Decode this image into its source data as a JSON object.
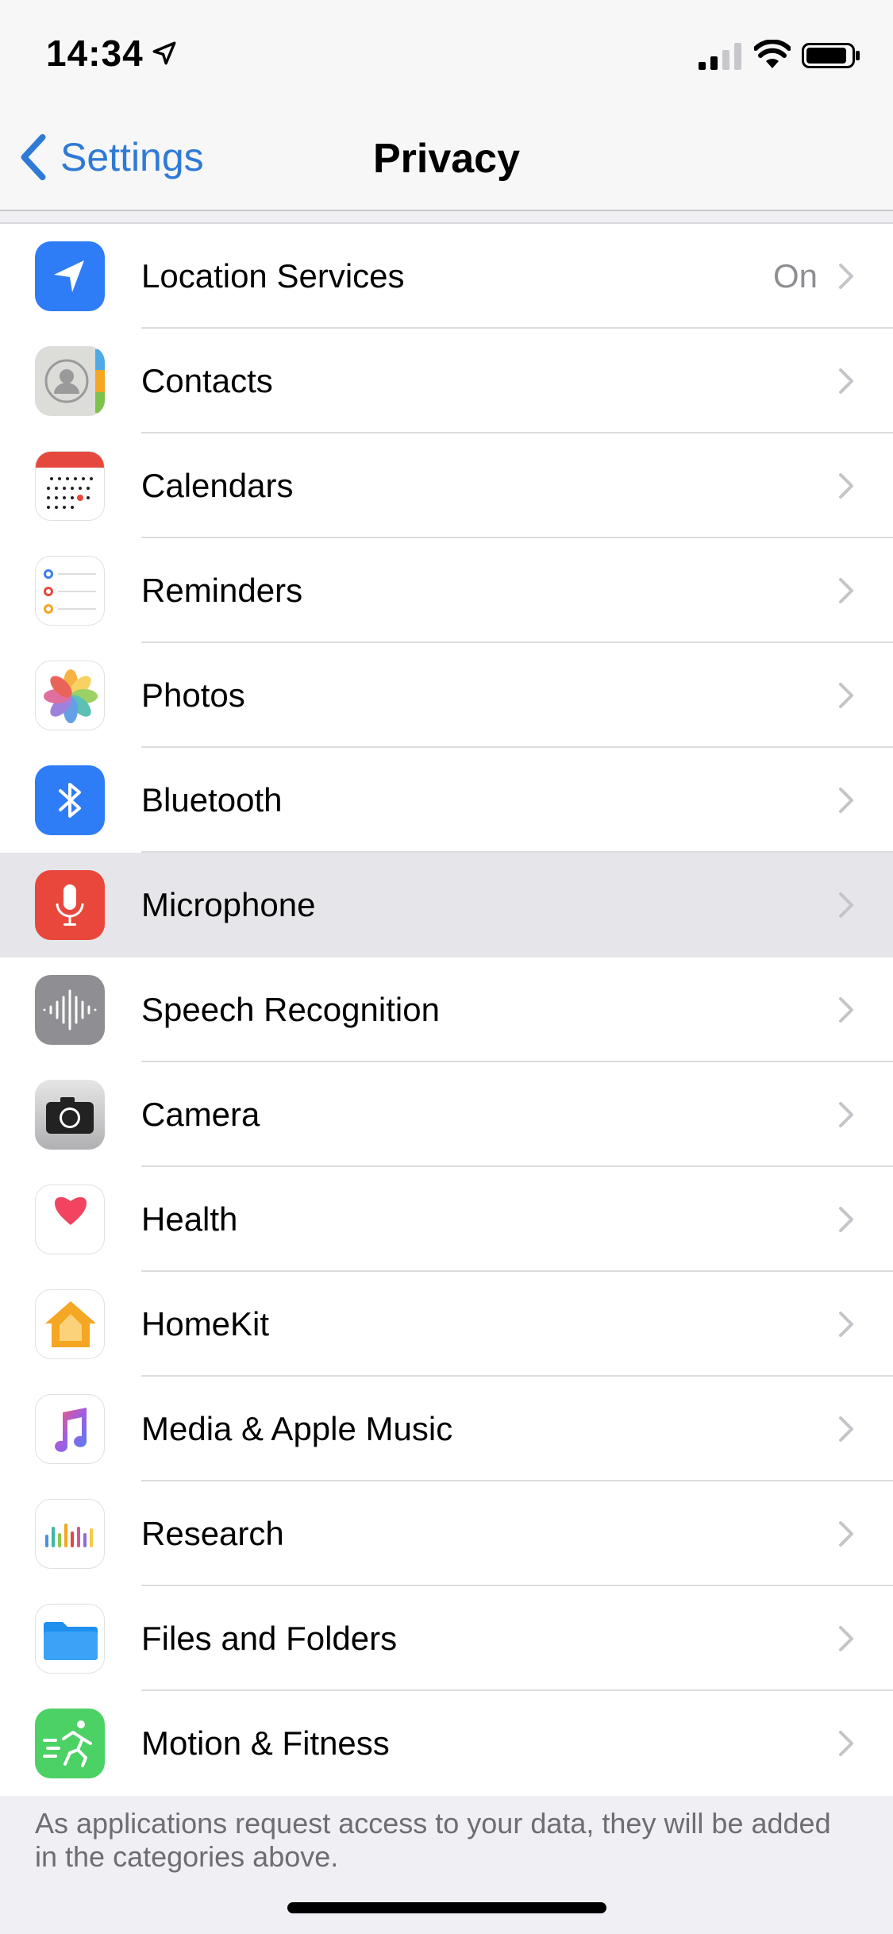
{
  "status_bar": {
    "time": "14:34"
  },
  "nav": {
    "back_label": "Settings",
    "title": "Privacy"
  },
  "rows": [
    {
      "label": "Location Services",
      "value": "On",
      "icon": "location-icon"
    },
    {
      "label": "Contacts",
      "icon": "contacts-icon"
    },
    {
      "label": "Calendars",
      "icon": "calendar-icon"
    },
    {
      "label": "Reminders",
      "icon": "reminders-icon"
    },
    {
      "label": "Photos",
      "icon": "photos-icon"
    },
    {
      "label": "Bluetooth",
      "icon": "bluetooth-icon"
    },
    {
      "label": "Microphone",
      "icon": "microphone-icon",
      "selected": true
    },
    {
      "label": "Speech Recognition",
      "icon": "speech-recognition-icon"
    },
    {
      "label": "Camera",
      "icon": "camera-icon"
    },
    {
      "label": "Health",
      "icon": "health-icon"
    },
    {
      "label": "HomeKit",
      "icon": "homekit-icon"
    },
    {
      "label": "Media & Apple Music",
      "icon": "music-icon"
    },
    {
      "label": "Research",
      "icon": "research-icon"
    },
    {
      "label": "Files and Folders",
      "icon": "files-folder-icon"
    },
    {
      "label": "Motion & Fitness",
      "icon": "motion-fitness-icon"
    }
  ],
  "footer": "As applications request access to your data, they will be added in the categories above.",
  "colors": {
    "accent": "#2f7ad6",
    "selected_row": "#e5e5ea"
  }
}
